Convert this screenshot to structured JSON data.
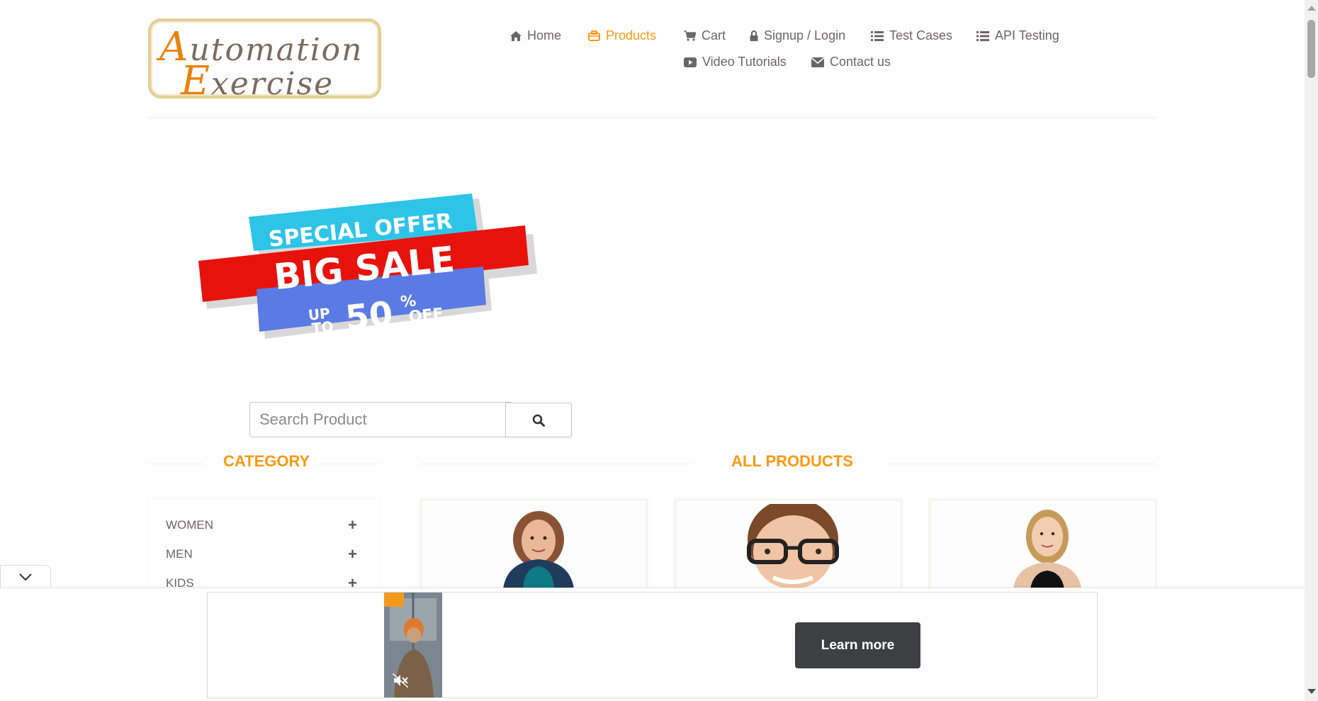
{
  "logo": {
    "line1_first": "A",
    "line1_rest": "utomation",
    "line2_first": "E",
    "line2_rest": "xercise"
  },
  "nav": {
    "items": [
      {
        "label": "Home",
        "icon": "home-icon"
      },
      {
        "label": "Products",
        "icon": "briefcase-icon",
        "active": true
      },
      {
        "label": "Cart",
        "icon": "cart-icon"
      },
      {
        "label": "Signup / Login",
        "icon": "lock-icon"
      },
      {
        "label": "Test Cases",
        "icon": "list-icon"
      },
      {
        "label": "API Testing",
        "icon": "list-icon"
      },
      {
        "label": "Video Tutorials",
        "icon": "youtube-icon"
      },
      {
        "label": "Contact us",
        "icon": "envelope-icon"
      }
    ],
    "active_color": "#fe980f"
  },
  "banner": {
    "line1": "SPECIAL OFFER",
    "line2": "BIG SALE",
    "up": "UP",
    "to": "TO",
    "percent_value": "50",
    "percent_sign": "%",
    "off": "OFF"
  },
  "search": {
    "placeholder": "Search Product",
    "value": "",
    "button_icon": "search-icon"
  },
  "sections": {
    "category_title": "Category",
    "products_title": "All Products"
  },
  "categories": [
    {
      "label": "Women",
      "toggle": "+"
    },
    {
      "label": "Men",
      "toggle": "+"
    },
    {
      "label": "Kids",
      "toggle": "+"
    }
  ],
  "products": [
    {
      "image": "woman-teal-top-photo"
    },
    {
      "image": "man-glasses-photo"
    },
    {
      "image": "woman-black-tank-photo"
    }
  ],
  "ad": {
    "cta_label": "Learn more",
    "collapse_icon": "chevron-down-icon",
    "mute_icon": "muted-speaker-icon"
  },
  "colors": {
    "accent": "#fe980f",
    "text": "#696763",
    "cta_bg": "#3c4043"
  }
}
